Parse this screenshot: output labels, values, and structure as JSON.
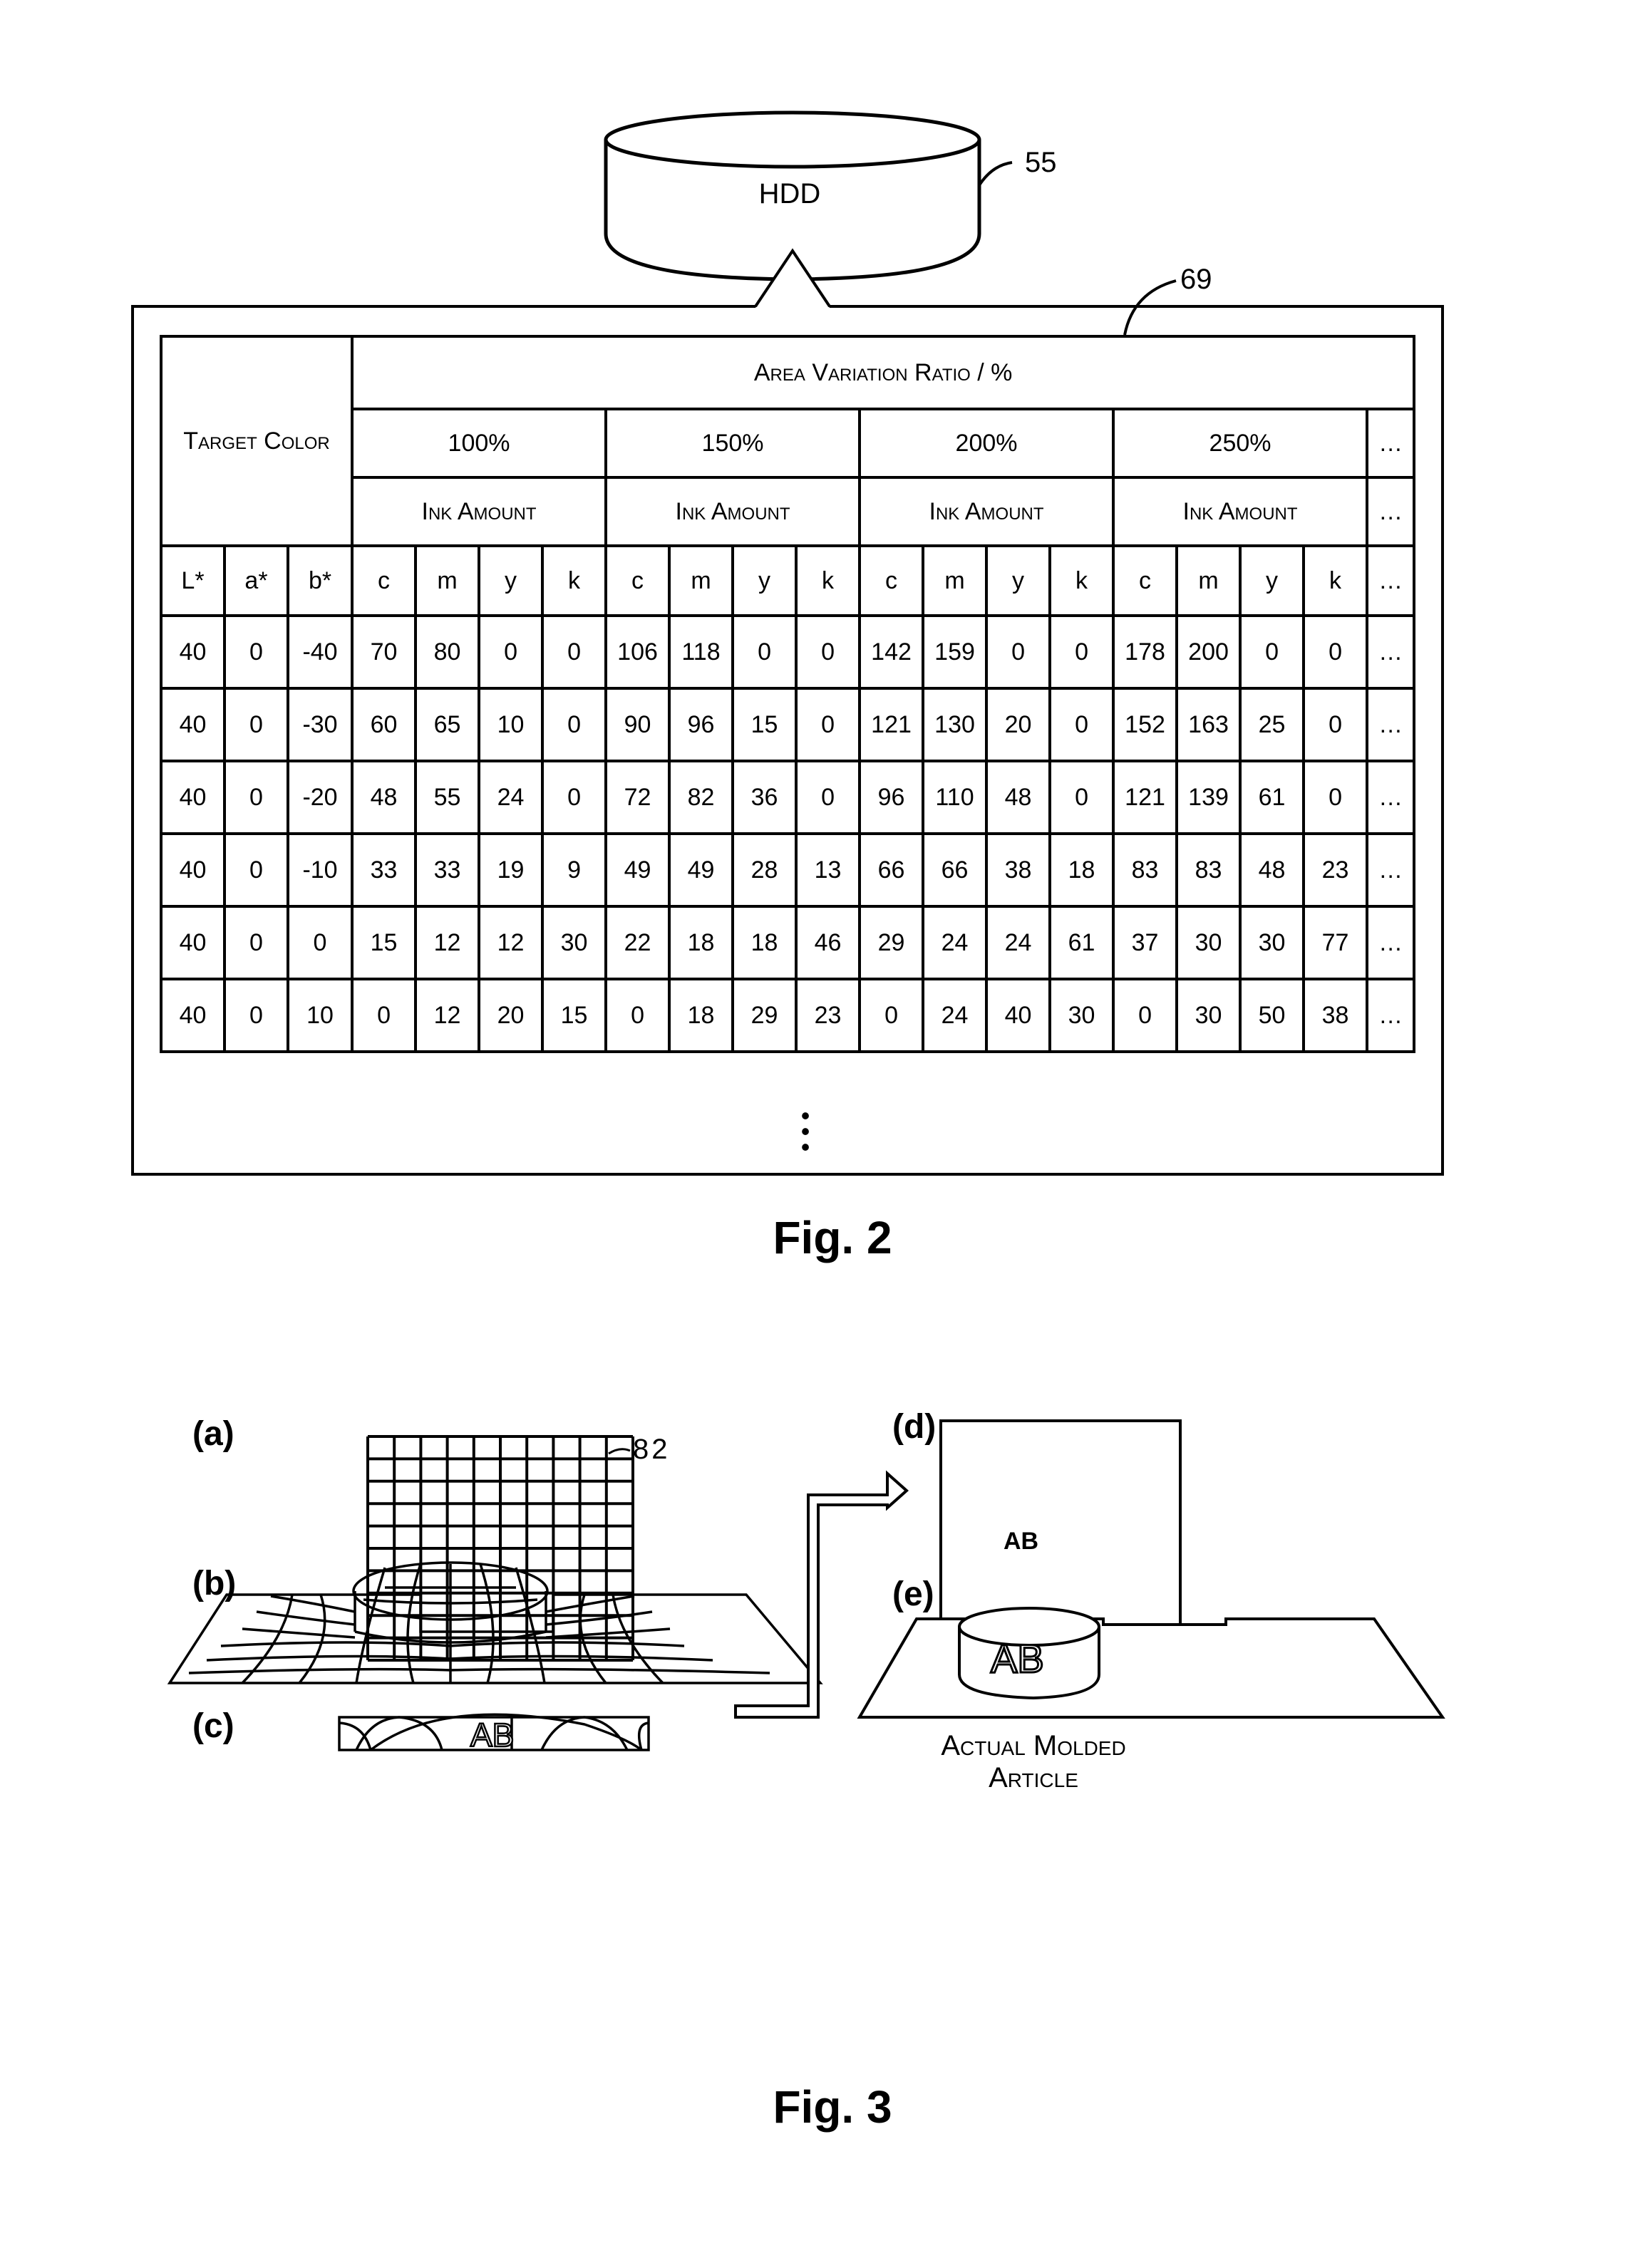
{
  "fig2": {
    "hdd_label": "HDD",
    "hdd_ref": "55",
    "table_ref": "69",
    "caption": "Fig. 2",
    "table": {
      "target_color_label": "Target Color",
      "area_variation_label": "Area Variation Ratio / %",
      "ratios": [
        "100%",
        "150%",
        "200%",
        "250%"
      ],
      "ink_amount_label": "Ink Amount",
      "more_marker": "…",
      "target_columns": [
        "L*",
        "a*",
        "b*"
      ],
      "ink_columns": [
        "c",
        "m",
        "y",
        "k"
      ],
      "rows": [
        {
          "lab": [
            40,
            0,
            -40
          ],
          "inks": [
            [
              70,
              80,
              0,
              0
            ],
            [
              106,
              118,
              0,
              0
            ],
            [
              142,
              159,
              0,
              0
            ],
            [
              178,
              200,
              0,
              0
            ]
          ]
        },
        {
          "lab": [
            40,
            0,
            -30
          ],
          "inks": [
            [
              60,
              65,
              10,
              0
            ],
            [
              90,
              96,
              15,
              0
            ],
            [
              121,
              130,
              20,
              0
            ],
            [
              152,
              163,
              25,
              0
            ]
          ]
        },
        {
          "lab": [
            40,
            0,
            -20
          ],
          "inks": [
            [
              48,
              55,
              24,
              0
            ],
            [
              72,
              82,
              36,
              0
            ],
            [
              96,
              110,
              48,
              0
            ],
            [
              121,
              139,
              61,
              0
            ]
          ]
        },
        {
          "lab": [
            40,
            0,
            -10
          ],
          "inks": [
            [
              33,
              33,
              19,
              9
            ],
            [
              49,
              49,
              28,
              13
            ],
            [
              66,
              66,
              38,
              18
            ],
            [
              83,
              83,
              48,
              23
            ]
          ]
        },
        {
          "lab": [
            40,
            0,
            0
          ],
          "inks": [
            [
              15,
              12,
              12,
              30
            ],
            [
              22,
              18,
              18,
              46
            ],
            [
              29,
              24,
              24,
              61
            ],
            [
              37,
              30,
              30,
              77
            ]
          ]
        },
        {
          "lab": [
            40,
            0,
            10
          ],
          "inks": [
            [
              0,
              12,
              20,
              15
            ],
            [
              0,
              18,
              29,
              23
            ],
            [
              0,
              24,
              40,
              30
            ],
            [
              0,
              30,
              50,
              38
            ]
          ]
        }
      ],
      "continuation": "⋮"
    }
  },
  "fig3": {
    "caption": "Fig. 3",
    "panels": {
      "a": "(a)",
      "b": "(b)",
      "c": "(c)",
      "d": "(d)",
      "e": "(e)"
    },
    "grid_ref": "82",
    "text_on_article": "AB",
    "article_label": "Actual Molded Article"
  }
}
